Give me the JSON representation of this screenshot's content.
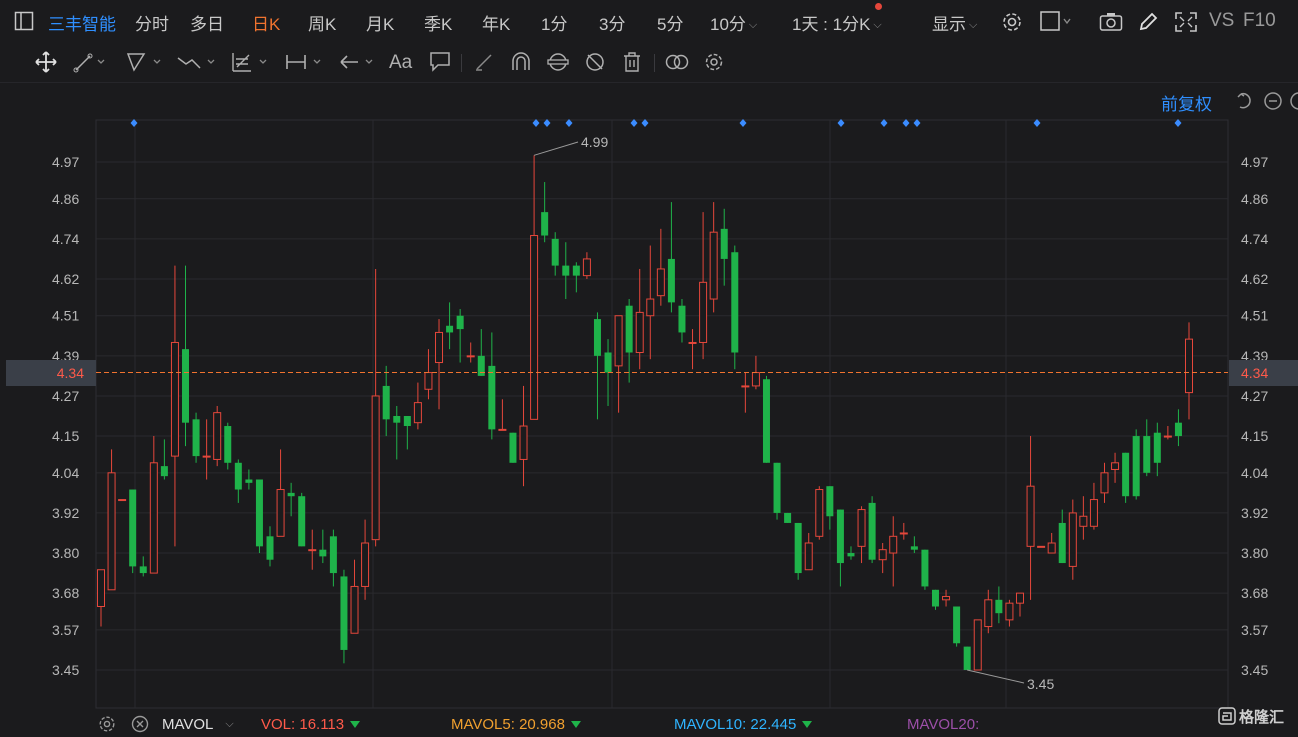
{
  "stock_name": "三丰智能",
  "periods": [
    {
      "label": "分时",
      "active": false
    },
    {
      "label": "多日",
      "active": false
    },
    {
      "label": "日K",
      "active": true
    },
    {
      "label": "周K",
      "active": false
    },
    {
      "label": "月K",
      "active": false
    },
    {
      "label": "季K",
      "active": false
    },
    {
      "label": "年K",
      "active": false
    },
    {
      "label": "1分",
      "active": false
    },
    {
      "label": "3分",
      "active": false
    },
    {
      "label": "5分",
      "active": false
    },
    {
      "label": "10分",
      "active": false
    }
  ],
  "period_combo": "1天 : 1分K",
  "display_label": "显示",
  "vs_label": "VS",
  "f10_label": "F10",
  "adjust_label": "前复权",
  "current_price": "4.34",
  "axis_ticks": [
    "4.97",
    "4.86",
    "4.74",
    "4.62",
    "4.51",
    "4.39",
    "4.27",
    "4.15",
    "4.04",
    "3.92",
    "3.80",
    "3.68",
    "3.57",
    "3.45"
  ],
  "annotations": {
    "high": "4.99",
    "low": "3.45"
  },
  "indicator": {
    "name": "MAVOL",
    "vol": "VOL: 16.113",
    "ma5": "MAVOL5: 20.968",
    "ma10": "MAVOL10: 22.445",
    "ma20": "MAVOL20:"
  },
  "watermark": "格隆汇",
  "colors": {
    "up": "#e5473b",
    "down": "#1fb34a",
    "accent": "#2f8fff",
    "active": "#f0732f"
  },
  "chart_data": {
    "type": "candlestick",
    "ylim": [
      3.4,
      5.02
    ],
    "candles": [
      [
        3.64,
        3.75,
        3.58,
        3.75
      ],
      [
        3.69,
        4.04,
        3.69,
        4.11
      ],
      [
        3.96,
        3.96,
        3.96,
        3.96
      ],
      [
        3.99,
        3.76,
        3.74,
        3.99
      ],
      [
        3.76,
        3.74,
        3.73,
        3.79
      ],
      [
        3.74,
        4.07,
        3.74,
        4.15
      ],
      [
        4.06,
        4.03,
        4.02,
        4.14
      ],
      [
        4.09,
        4.43,
        3.82,
        4.66
      ],
      [
        4.41,
        4.19,
        4.12,
        4.66
      ],
      [
        4.2,
        4.09,
        4.07,
        4.22
      ],
      [
        4.09,
        4.09,
        4.02,
        4.2
      ],
      [
        4.08,
        4.22,
        4.06,
        4.24
      ],
      [
        4.18,
        4.07,
        4.05,
        4.19
      ],
      [
        4.07,
        3.99,
        3.95,
        4.08
      ],
      [
        4.02,
        4.01,
        3.99,
        4.05
      ],
      [
        4.02,
        3.82,
        3.8,
        4.02
      ],
      [
        3.85,
        3.78,
        3.76,
        3.88
      ],
      [
        3.85,
        3.99,
        3.85,
        4.11
      ],
      [
        3.98,
        3.97,
        3.91,
        4.01
      ],
      [
        3.97,
        3.82,
        3.82,
        3.98
      ],
      [
        3.81,
        3.81,
        3.75,
        3.87
      ],
      [
        3.81,
        3.79,
        3.77,
        3.87
      ],
      [
        3.85,
        3.74,
        3.7,
        3.87
      ],
      [
        3.73,
        3.51,
        3.47,
        3.75
      ],
      [
        3.56,
        3.7,
        3.56,
        3.78
      ],
      [
        3.7,
        3.83,
        3.66,
        3.9
      ],
      [
        3.84,
        4.27,
        3.82,
        4.65
      ],
      [
        4.3,
        4.2,
        4.15,
        4.36
      ],
      [
        4.21,
        4.19,
        4.08,
        4.24
      ],
      [
        4.21,
        4.18,
        4.11,
        4.21
      ],
      [
        4.19,
        4.25,
        4.17,
        4.31
      ],
      [
        4.29,
        4.34,
        4.26,
        4.41
      ],
      [
        4.37,
        4.46,
        4.23,
        4.5
      ],
      [
        4.48,
        4.46,
        4.41,
        4.55
      ],
      [
        4.51,
        4.47,
        4.37,
        4.53
      ],
      [
        4.39,
        4.39,
        4.37,
        4.43
      ],
      [
        4.39,
        4.33,
        4.33,
        4.47
      ],
      [
        4.36,
        4.17,
        4.14,
        4.46
      ],
      [
        4.17,
        4.17,
        4.17,
        4.26
      ],
      [
        4.16,
        4.07,
        4.07,
        4.16
      ],
      [
        4.08,
        4.18,
        4.0,
        4.3
      ],
      [
        4.2,
        4.75,
        4.2,
        4.99
      ],
      [
        4.82,
        4.75,
        4.73,
        4.91
      ],
      [
        4.74,
        4.66,
        4.63,
        4.76
      ],
      [
        4.66,
        4.63,
        4.56,
        4.73
      ],
      [
        4.66,
        4.63,
        4.58,
        4.67
      ],
      [
        4.63,
        4.68,
        4.62,
        4.7
      ],
      [
        4.5,
        4.39,
        4.2,
        4.52
      ],
      [
        4.4,
        4.34,
        4.24,
        4.44
      ],
      [
        4.36,
        4.51,
        4.22,
        4.51
      ],
      [
        4.54,
        4.4,
        4.31,
        4.56
      ],
      [
        4.4,
        4.52,
        4.35,
        4.65
      ],
      [
        4.51,
        4.56,
        4.38,
        4.72
      ],
      [
        4.57,
        4.65,
        4.54,
        4.77
      ],
      [
        4.68,
        4.55,
        4.52,
        4.85
      ],
      [
        4.54,
        4.46,
        4.43,
        4.56
      ],
      [
        4.43,
        4.43,
        4.35,
        4.47
      ],
      [
        4.43,
        4.61,
        4.38,
        4.82
      ],
      [
        4.56,
        4.76,
        4.52,
        4.85
      ],
      [
        4.77,
        4.68,
        4.6,
        4.83
      ],
      [
        4.7,
        4.4,
        4.35,
        4.72
      ],
      [
        4.3,
        4.3,
        4.22,
        4.34
      ],
      [
        4.3,
        4.34,
        4.29,
        4.39
      ],
      [
        4.32,
        4.07,
        4.07,
        4.33
      ],
      [
        4.07,
        3.92,
        3.9,
        4.07
      ],
      [
        3.92,
        3.89,
        3.89,
        3.92
      ],
      [
        3.89,
        3.74,
        3.72,
        3.89
      ],
      [
        3.75,
        3.83,
        3.75,
        3.86
      ],
      [
        3.85,
        3.99,
        3.84,
        4.0
      ],
      [
        4.0,
        3.91,
        3.87,
        4.0
      ],
      [
        3.93,
        3.77,
        3.7,
        3.93
      ],
      [
        3.8,
        3.79,
        3.78,
        3.82
      ],
      [
        3.82,
        3.93,
        3.77,
        3.94
      ],
      [
        3.95,
        3.78,
        3.77,
        3.97
      ],
      [
        3.78,
        3.81,
        3.74,
        3.83
      ],
      [
        3.8,
        3.85,
        3.7,
        3.91
      ],
      [
        3.86,
        3.86,
        3.84,
        3.89
      ],
      [
        3.82,
        3.81,
        3.8,
        3.85
      ],
      [
        3.81,
        3.7,
        3.69,
        3.81
      ],
      [
        3.69,
        3.64,
        3.63,
        3.69
      ],
      [
        3.66,
        3.67,
        3.64,
        3.69
      ],
      [
        3.64,
        3.53,
        3.52,
        3.64
      ],
      [
        3.52,
        3.45,
        3.45,
        3.52
      ],
      [
        3.45,
        3.6,
        3.45,
        3.6
      ],
      [
        3.58,
        3.66,
        3.56,
        3.69
      ],
      [
        3.66,
        3.62,
        3.59,
        3.7
      ],
      [
        3.6,
        3.65,
        3.58,
        3.66
      ],
      [
        3.65,
        3.68,
        3.61,
        3.68
      ],
      [
        3.82,
        4.0,
        3.66,
        4.15
      ],
      [
        3.82,
        3.82,
        3.82,
        3.82
      ],
      [
        3.8,
        3.83,
        3.8,
        3.86
      ],
      [
        3.89,
        3.77,
        3.77,
        3.93
      ],
      [
        3.76,
        3.92,
        3.72,
        3.96
      ],
      [
        3.88,
        3.91,
        3.84,
        3.97
      ],
      [
        3.88,
        3.96,
        3.87,
        4.01
      ],
      [
        3.98,
        4.04,
        3.95,
        4.07
      ],
      [
        4.05,
        4.07,
        4.01,
        4.1
      ],
      [
        4.1,
        3.97,
        3.95,
        4.1
      ],
      [
        4.15,
        3.97,
        3.96,
        4.17
      ],
      [
        4.15,
        4.04,
        4.03,
        4.2
      ],
      [
        4.16,
        4.07,
        4.03,
        4.19
      ],
      [
        4.15,
        4.15,
        4.14,
        4.18
      ],
      [
        4.19,
        4.15,
        4.12,
        4.23
      ],
      [
        4.28,
        4.44,
        4.2,
        4.49
      ]
    ]
  }
}
